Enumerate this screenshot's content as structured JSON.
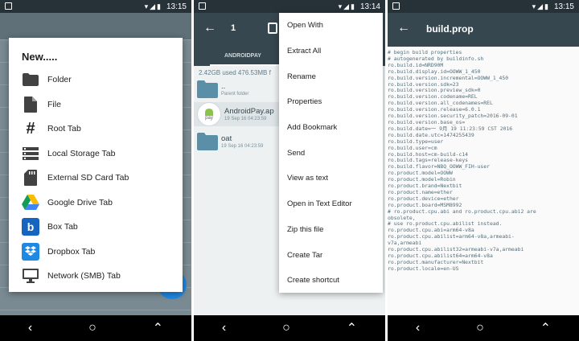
{
  "colors": {
    "appbar": "#37474f",
    "statusbar": "#263238",
    "accent": "#1e88e5"
  },
  "status": {
    "time1": "13:15",
    "time2": "13:14",
    "time3": "13:15"
  },
  "new_dialog": {
    "title": "New.....",
    "items": [
      {
        "label": "Folder",
        "icon": "folder-icon"
      },
      {
        "label": "File",
        "icon": "file-icon"
      },
      {
        "label": "Root Tab",
        "icon": "hash-icon"
      },
      {
        "label": "Local Storage Tab",
        "icon": "storage-list-icon"
      },
      {
        "label": "External SD Card Tab",
        "icon": "sd-card-icon"
      },
      {
        "label": "Google Drive Tab",
        "icon": "google-drive-icon"
      },
      {
        "label": "Box Tab",
        "icon": "box-icon"
      },
      {
        "label": "Dropbox Tab",
        "icon": "dropbox-icon"
      },
      {
        "label": "Network (SMB) Tab",
        "icon": "monitor-icon"
      }
    ]
  },
  "file_browser": {
    "selected_count": "1",
    "tab_label": "ANDROIDPAY",
    "storage_info": "2.42GB used 476.53MB f",
    "rows": [
      {
        "name": "..",
        "sub": "Parent folder"
      },
      {
        "name": "AndroidPay.ap",
        "sub": "19 Sep 16 04:23:59",
        "badge": "pay"
      },
      {
        "name": "oat",
        "sub": "19 Sep 16 04:23:59"
      }
    ]
  },
  "context_menu": {
    "items": [
      "Open With",
      "Extract All",
      "Rename",
      "Properties",
      "Add Bookmark",
      "Send",
      "View as text",
      "Open in Text Editor",
      "Zip this file",
      "Create Tar",
      "Create shortcut"
    ]
  },
  "text_viewer": {
    "title": "build.prop",
    "lines": [
      "# begin build properties",
      "# autogenerated by buildinfo.sh",
      "ro.build.id=NRD90M",
      "ro.build.display.id=OOWW_1_450",
      "ro.build.version.incremental=OOWW_1_450",
      "ro.build.version.sdk=23",
      "ro.build.version.preview_sdk=0",
      "ro.build.version.codename=REL",
      "ro.build.version.all_codenames=REL",
      "ro.build.version.release=6.0.1",
      "ro.build.version.security_patch=2016-09-01",
      "ro.build.version.base_os=",
      "ro.build.date=一 9月 19 11:23:59 CST 2016",
      "ro.build.date.utc=1474255439",
      "ro.build.type=user",
      "ro.build.user=cm",
      "ro.build.host=cm-build-c14",
      "ro.build.tags=release-keys",
      "ro.build.flavor=NBQ_OOWW_FIH-user",
      "ro.product.model=OOWW",
      "ro.product.model=Robin",
      "ro.product.brand=Nextbit",
      "ro.product.name=ether",
      "ro.product.device=ether",
      "ro.product.board=MSM8992",
      "# ro.product.cpu.abi and ro.product.cpu.abi2 are",
      "obsolete,",
      "# use ro.product.cpu.abilist instead.",
      "ro.product.cpu.abi=arm64-v8a",
      "ro.product.cpu.abilist=arm64-v8a,armeabi-",
      "v7a,armeabi",
      "ro.product.cpu.abilist32=armeabi-v7a,armeabi",
      "ro.product.cpu.abilist64=arm64-v8a",
      "ro.product.manufacturer=Nextbit",
      "ro.product.locale=en-US"
    ]
  },
  "nav": {
    "back": "‹",
    "home": "○",
    "recents": "⌃"
  }
}
